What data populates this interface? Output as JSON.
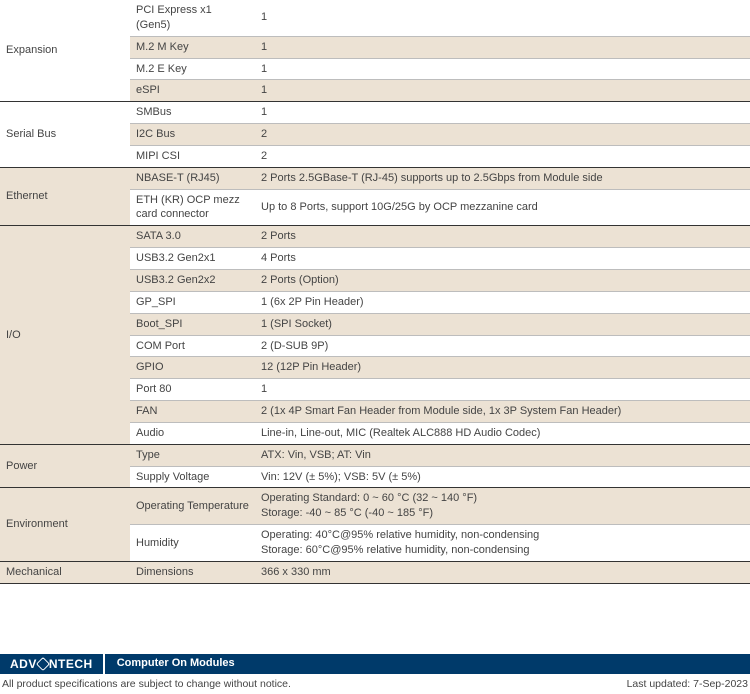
{
  "rows": [
    {
      "cat": "Expansion",
      "catSpan": 4,
      "sub": "PCI Express x1 (Gen5)",
      "val": "1",
      "tone": "even",
      "topBorder": "none"
    },
    {
      "sub": "M.2 M Key",
      "val": "1",
      "tone": "odd",
      "topBorder": "light"
    },
    {
      "sub": "M.2 E Key",
      "val": "1",
      "tone": "even",
      "topBorder": "light"
    },
    {
      "sub": "eSPI",
      "val": "1",
      "tone": "odd",
      "topBorder": "light"
    },
    {
      "cat": "Serial Bus",
      "catSpan": 3,
      "sub": "SMBus",
      "val": "1",
      "tone": "even",
      "topBorder": "dark"
    },
    {
      "sub": "I2C Bus",
      "val": "2",
      "tone": "odd",
      "topBorder": "light"
    },
    {
      "sub": "MIPI CSI",
      "val": "2",
      "tone": "even",
      "topBorder": "light"
    },
    {
      "cat": "Ethernet",
      "catSpan": 2,
      "sub": "NBASE-T (RJ45)",
      "val": "2 Ports 2.5GBase-T (RJ-45) supports up to 2.5Gbps from Module side",
      "tone": "odd",
      "topBorder": "dark"
    },
    {
      "sub": "ETH (KR) OCP mezz card connector",
      "val": "Up to 8 Ports, support 10G/25G by OCP mezzanine card",
      "tone": "even",
      "topBorder": "light"
    },
    {
      "cat": "I/O",
      "catSpan": 10,
      "sub": "SATA 3.0",
      "val": "2 Ports",
      "tone": "odd",
      "topBorder": "dark"
    },
    {
      "sub": "USB3.2 Gen2x1",
      "val": "4 Ports",
      "tone": "even",
      "topBorder": "light"
    },
    {
      "sub": "USB3.2 Gen2x2",
      "val": "2 Ports (Option)",
      "tone": "odd",
      "topBorder": "light"
    },
    {
      "sub": "GP_SPI",
      "val": "1 (6x 2P Pin Header)",
      "tone": "even",
      "topBorder": "light"
    },
    {
      "sub": "Boot_SPI",
      "val": "1 (SPI Socket)",
      "tone": "odd",
      "topBorder": "light"
    },
    {
      "sub": "COM Port",
      "val": "2 (D-SUB 9P)",
      "tone": "even",
      "topBorder": "light"
    },
    {
      "sub": "GPIO",
      "val": "12 (12P Pin Header)",
      "tone": "odd",
      "topBorder": "light"
    },
    {
      "sub": "Port 80",
      "val": "1",
      "tone": "even",
      "topBorder": "light"
    },
    {
      "sub": "FAN",
      "val": "2 (1x 4P Smart Fan Header from Module side, 1x 3P System Fan Header)",
      "tone": "odd",
      "topBorder": "light"
    },
    {
      "sub": "Audio",
      "val": "Line-in, Line-out, MIC (Realtek ALC888 HD Audio Codec)",
      "tone": "even",
      "topBorder": "light"
    },
    {
      "cat": "Power",
      "catSpan": 2,
      "sub": "Type",
      "val": "ATX: Vin, VSB; AT: Vin",
      "tone": "odd",
      "topBorder": "dark"
    },
    {
      "sub": "Supply Voltage",
      "val": "Vin: 12V (± 5%); VSB: 5V (± 5%)",
      "tone": "even",
      "topBorder": "light"
    },
    {
      "cat": "Environment",
      "catSpan": 2,
      "sub": "Operating Temperature",
      "val": "Operating Standard: 0 ~ 60 °C (32 ~ 140 °F)\nStorage: -40 ~ 85 °C (-40 ~ 185 °F)",
      "tone": "odd",
      "topBorder": "dark"
    },
    {
      "sub": "Humidity",
      "val": "Operating: 40°C@95% relative humidity, non-condensing\nStorage: 60°C@95% relative humidity, non-condensing",
      "tone": "even",
      "topBorder": "light"
    },
    {
      "cat": "Mechanical",
      "catSpan": 1,
      "sub": "Dimensions",
      "val": "366 x 330 mm",
      "tone": "odd",
      "topBorder": "dark",
      "bottomBorder": "dark"
    }
  ],
  "footer": {
    "brand_bold": "ADV",
    "brand_bold2": "NTECH",
    "section": "Computer On Modules",
    "disclaimer": "All product specifications are subject to change without notice.",
    "updated": "Last updated: 7-Sep-2023"
  }
}
